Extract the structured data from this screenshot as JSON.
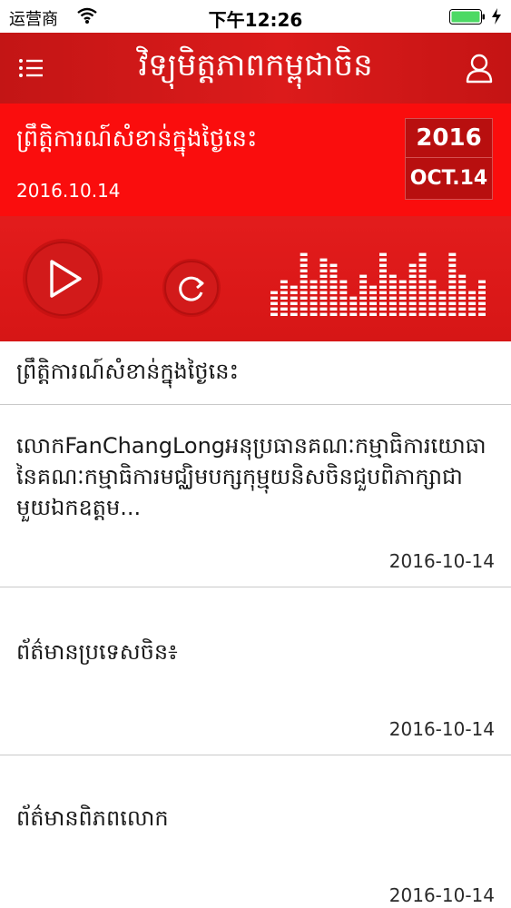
{
  "status_bar": {
    "carrier": "运营商",
    "time": "下午12:26"
  },
  "nav": {
    "title": "វិទ្យុមិត្តភាពកម្ពុជាចិន",
    "left_icon": "list-menu-icon",
    "right_icon": "user-icon"
  },
  "today": {
    "title": "ព្រឹត្តិការណ៍សំខាន់ក្នុងថ្ងៃនេះ",
    "date": "2016.10.14",
    "calendar_year": "2016",
    "calendar_day": "OCT.14"
  },
  "player": {
    "play_icon": "play-icon",
    "refresh_icon": "refresh-icon",
    "equalizer_levels": [
      0.35,
      0.55,
      0.45,
      0.95,
      0.5,
      0.85,
      0.75,
      0.5,
      0.3,
      0.6,
      0.45,
      0.95,
      0.65,
      0.5,
      0.75,
      0.95,
      0.55,
      0.4,
      0.9,
      0.65,
      0.35,
      0.55
    ]
  },
  "section": {
    "title": "ព្រឹត្តិការណ៍សំខាន់ក្នុងថ្ងៃនេះ"
  },
  "news": [
    {
      "title": "លោកFanChangLongអនុប្រធានគណៈកម្មាធិការយោធានៃគណៈកម្មាធិការមជ្ឈិមបក្សកុម្មុយនិសចិនជួបពិភាក្សាជាមួយឯកឧត្តម...",
      "date": "2016-10-14"
    },
    {
      "title": "ព័ត៌មានប្រទេសចិន៖",
      "date": "2016-10-14"
    },
    {
      "title": "ព័ត៌មានពិភពលោក",
      "date": "2016-10-14"
    }
  ],
  "colors": {
    "nav": "#d01818",
    "today_bg": "#fa0d0d",
    "player_bg": "#dc1919",
    "calendar_bg": "#b80f0f"
  }
}
